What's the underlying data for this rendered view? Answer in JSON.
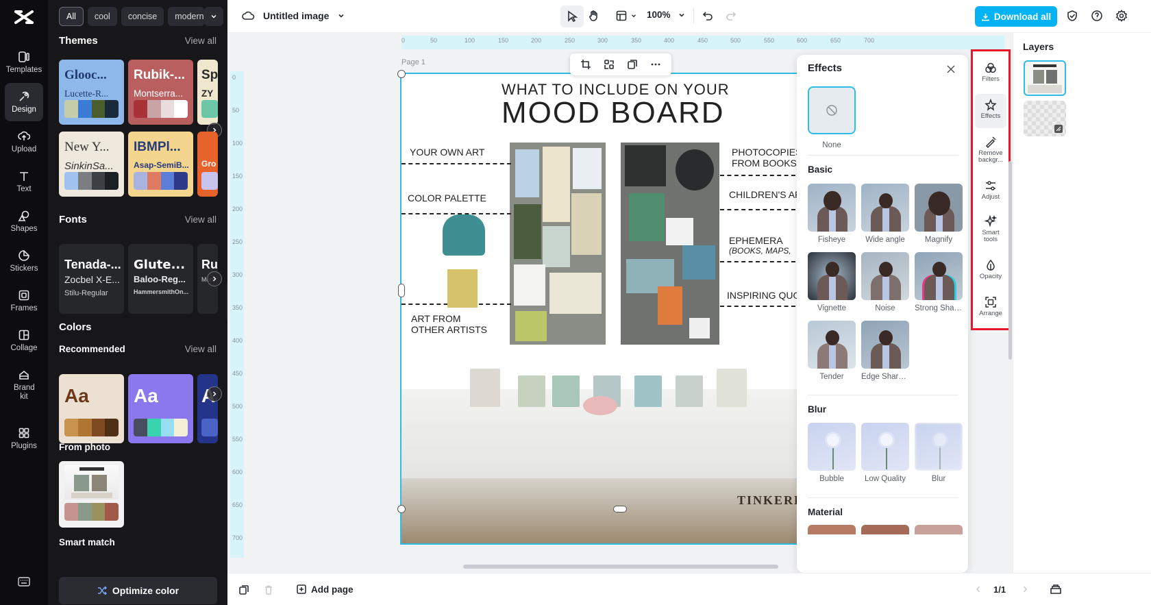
{
  "rail": {
    "items": [
      {
        "label": "Templates",
        "icon": "templates-icon"
      },
      {
        "label": "Design",
        "icon": "design-icon"
      },
      {
        "label": "Upload",
        "icon": "upload-icon"
      },
      {
        "label": "Text",
        "icon": "text-icon"
      },
      {
        "label": "Shapes",
        "icon": "shapes-icon"
      },
      {
        "label": "Stickers",
        "icon": "stickers-icon"
      },
      {
        "label": "Frames",
        "icon": "frames-icon"
      },
      {
        "label": "Collage",
        "icon": "collage-icon"
      },
      {
        "label": "Brand kit",
        "icon": "brand-kit-icon"
      },
      {
        "label": "Plugins",
        "icon": "plugins-icon"
      }
    ],
    "active": "Design"
  },
  "panel": {
    "chips": [
      "All",
      "cool",
      "concise",
      "modern"
    ],
    "themes": {
      "title": "Themes",
      "view_all": "View all",
      "cards": [
        {
          "t1": "Glooc...",
          "t2": "Lucette-R...",
          "bg": "#8fb8ea",
          "fg": "#1f3a6b",
          "colors": [
            "#c5ccaa",
            "#3a7bd5",
            "#4a5d2c",
            "#1a2a3a"
          ]
        },
        {
          "t1": "Rubik-...",
          "t2": "Montserra...",
          "bg": "#b95f5f",
          "fg": "#ffffff",
          "colors": [
            "#a83236",
            "#caa3a6",
            "#e8dcdc",
            "#ffffff"
          ]
        },
        {
          "t1": "Sp",
          "t2": "ZY",
          "bg": "#f0e7cf",
          "fg": "#2b2b2b",
          "colors": [
            "#6cc7a8",
            "#3a8f76"
          ]
        },
        {
          "t1": "New Y...",
          "t2": "SinkinSa...",
          "bg": "#efe8dd",
          "fg": "#333333",
          "colors": [
            "#9fc3ee",
            "#7a7d82",
            "#3d4147",
            "#1c1f24"
          ]
        },
        {
          "t1": "IBMPl...",
          "t2": "Asap-SemiB...",
          "bg": "#f3d58e",
          "fg": "#253a7a",
          "colors": [
            "#a8b3e2",
            "#e07a63",
            "#5c7ed8",
            "#2f3a8a"
          ]
        },
        {
          "t1": "Gro",
          "t2": "",
          "bg": "#e8622c",
          "fg": "#ffffff",
          "colors": [
            "#c9c3f0"
          ]
        }
      ]
    },
    "fonts": {
      "title": "Fonts",
      "view_all": "View all",
      "cards": [
        {
          "f1": "Tenada-...",
          "f2": "Zocbel X-E...",
          "f3": "Stilu-Regular"
        },
        {
          "f1": "Glute...",
          "f2": "Baloo-Reg...",
          "f3": "HammersmithOn..."
        },
        {
          "f1": "Ru",
          "f2": "",
          "f3": "Mon"
        }
      ]
    },
    "colors": {
      "title": "Colors",
      "recommended": "Recommended",
      "view_all": "View all",
      "aa": "Aa",
      "cards": [
        {
          "bg": "#ece0d3",
          "fg": "#6a3a1a",
          "colors": [
            "#c8934f",
            "#b07433",
            "#7f4a21",
            "#4f2f16"
          ]
        },
        {
          "bg": "#8b78ee",
          "fg": "#ffffff",
          "colors": [
            "#4a4d60",
            "#39d3b0",
            "#98ddf2",
            "#f4f0d8"
          ]
        },
        {
          "bg": "#24348a",
          "fg": "#ffffff",
          "colors": [
            "#4a63c7"
          ]
        }
      ],
      "from_photo": "From photo",
      "photo_colors": [
        "#c6958f",
        "#8a9a8a",
        "#9a9160",
        "#a3594a"
      ],
      "smart_match": "Smart match",
      "optimize": "Optimize color"
    }
  },
  "topbar": {
    "title": "Untitled image",
    "zoom": "100%",
    "download": "Download all"
  },
  "canvas": {
    "page_label": "Page 1",
    "ruler_h": [
      "0",
      "50",
      "100",
      "150",
      "200",
      "250",
      "300",
      "350",
      "400",
      "450",
      "500",
      "550",
      "600",
      "650",
      "700"
    ],
    "ruler_v": [
      "0",
      "50",
      "100",
      "150",
      "200",
      "250",
      "300",
      "350",
      "400",
      "450",
      "500",
      "550",
      "600",
      "650",
      "700"
    ],
    "image": {
      "heading_small": "WHAT TO INCLUDE ON YOUR",
      "heading_big": "MOOD BOARD",
      "labels_left": [
        "YOUR OWN ART",
        "COLOR PALETTE",
        "ART FROM",
        "OTHER ARTISTS"
      ],
      "labels_right": [
        "PHOTOCOPIES",
        "FROM BOOKS",
        "CHILDREN'S AR",
        "EPHEMERA",
        "(BOOKS, MAPS,",
        "INSPIRING QUO"
      ],
      "brand": "TINKERL"
    }
  },
  "effects": {
    "title": "Effects",
    "none_label": "None",
    "basic": {
      "title": "Basic",
      "items": [
        "Fisheye",
        "Wide angle",
        "Magnify",
        "Vignette",
        "Noise",
        "Strong Shar...",
        "Tender",
        "Edge Sharp..."
      ]
    },
    "blur": {
      "title": "Blur",
      "items": [
        "Bubble",
        "Low Quality",
        "Blur"
      ]
    },
    "material": {
      "title": "Material"
    }
  },
  "tools": [
    {
      "label": "Filters",
      "icon": "filters-icon"
    },
    {
      "label": "Effects",
      "icon": "effects-icon"
    },
    {
      "label": "Remove backgr...",
      "icon": "remove-background-icon"
    },
    {
      "label": "Adjust",
      "icon": "adjust-icon"
    },
    {
      "label": "Smart tools",
      "icon": "smart-tools-icon"
    },
    {
      "label": "Opacity",
      "icon": "opacity-icon"
    },
    {
      "label": "Arrange",
      "icon": "arrange-icon"
    }
  ],
  "layers": {
    "title": "Layers"
  },
  "bottombar": {
    "add_page": "Add page",
    "page_count": "1/1"
  },
  "accent": "#00b3f5",
  "highlight": "#e8162b"
}
